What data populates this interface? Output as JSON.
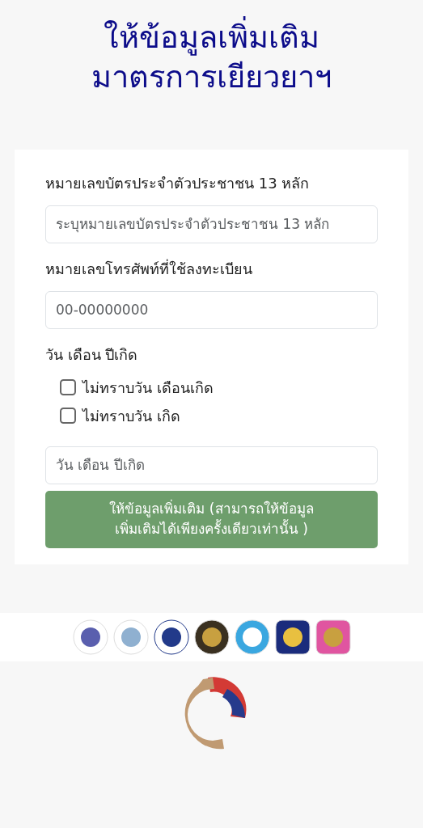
{
  "title": [
    "ให้ข้อมูลเพิ่มเติม",
    "มาตรการเยียวยาฯ"
  ],
  "form": {
    "id_field": {
      "label": "หมายเลขบัตรประจำตัวประชาชน 13 หลัก",
      "placeholder": "ระบุหมายเลขบัตรประจำตัวประชาชน 13 หลัก"
    },
    "phone_field": {
      "label": "หมายเลขโทรศัพท์ที่ใช้ลงทะเบียน",
      "placeholder": "00-00000000"
    },
    "birth": {
      "label": "วัน เดือน ปีเกิด",
      "options": [
        {
          "label": "ไม่ทราบวัน เดือนเกิด",
          "checked": false
        },
        {
          "label": "ไม่ทราบวัน เกิด",
          "checked": false
        }
      ],
      "placeholder": "วัน เดือน ปีเกิด"
    },
    "submit": [
      "ให้ข้อมูลเพิ่มเติม (สามารถให้ข้อมูล",
      "เพิ่มเติมได้เพียงครั้งเดียวเท่านั้น )"
    ]
  }
}
